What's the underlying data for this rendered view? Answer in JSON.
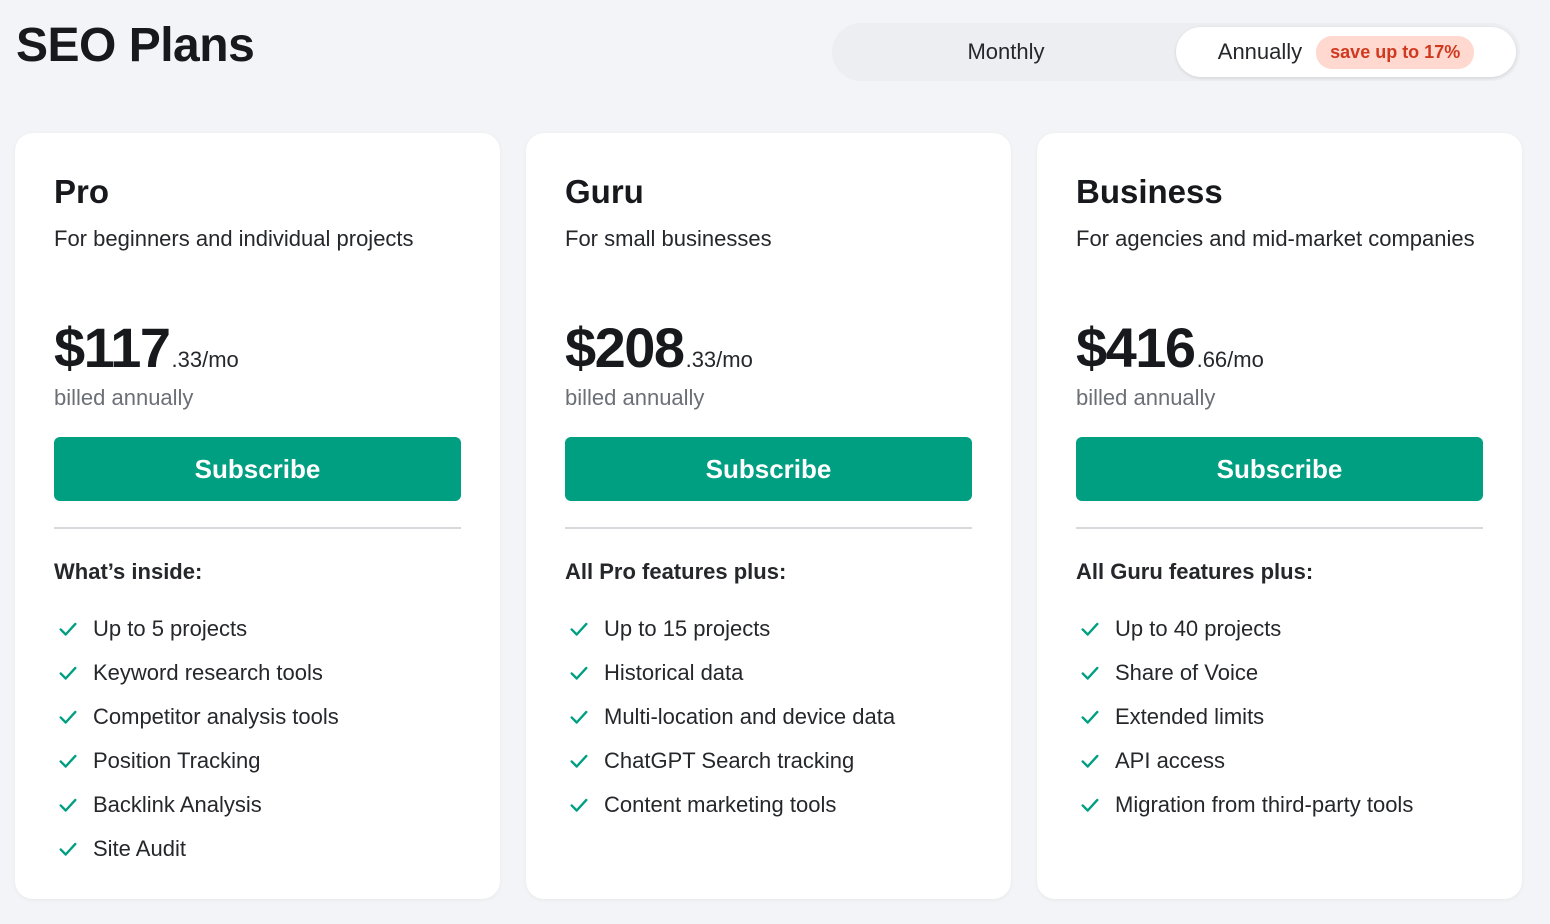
{
  "header": {
    "title": "SEO Plans"
  },
  "billing_toggle": {
    "monthly_label": "Monthly",
    "annually_label": "Annually",
    "save_badge": "save up to 17%",
    "selected": "Annually"
  },
  "colors": {
    "accent_green": "#009f81",
    "badge_bg": "#ffd8cf",
    "badge_text": "#d0391f",
    "check_icon": "#009f81"
  },
  "plans": [
    {
      "name": "Pro",
      "description": "For beginners and individual projects",
      "price_main": "$117",
      "price_cents": ".33/mo",
      "billed": "billed annually",
      "subscribe_label": "Subscribe",
      "features_title": "What’s inside:",
      "features": [
        "Up to 5 projects",
        "Keyword research tools",
        "Competitor analysis tools",
        "Position Tracking",
        "Backlink Analysis",
        "Site Audit"
      ]
    },
    {
      "name": "Guru",
      "description": "For small businesses",
      "price_main": "$208",
      "price_cents": ".33/mo",
      "billed": "billed annually",
      "subscribe_label": "Subscribe",
      "features_title": "All Pro features plus:",
      "features": [
        "Up to 15 projects",
        "Historical data",
        "Multi-location and device data",
        "ChatGPT Search tracking",
        "Content marketing tools"
      ]
    },
    {
      "name": "Business",
      "description": "For agencies and mid-market companies",
      "price_main": "$416",
      "price_cents": ".66/mo",
      "billed": "billed annually",
      "subscribe_label": "Subscribe",
      "features_title": "All Guru features plus:",
      "features": [
        "Up to 40 projects",
        "Share of Voice",
        "Extended limits",
        "API access",
        "Migration from third-party tools"
      ]
    }
  ]
}
